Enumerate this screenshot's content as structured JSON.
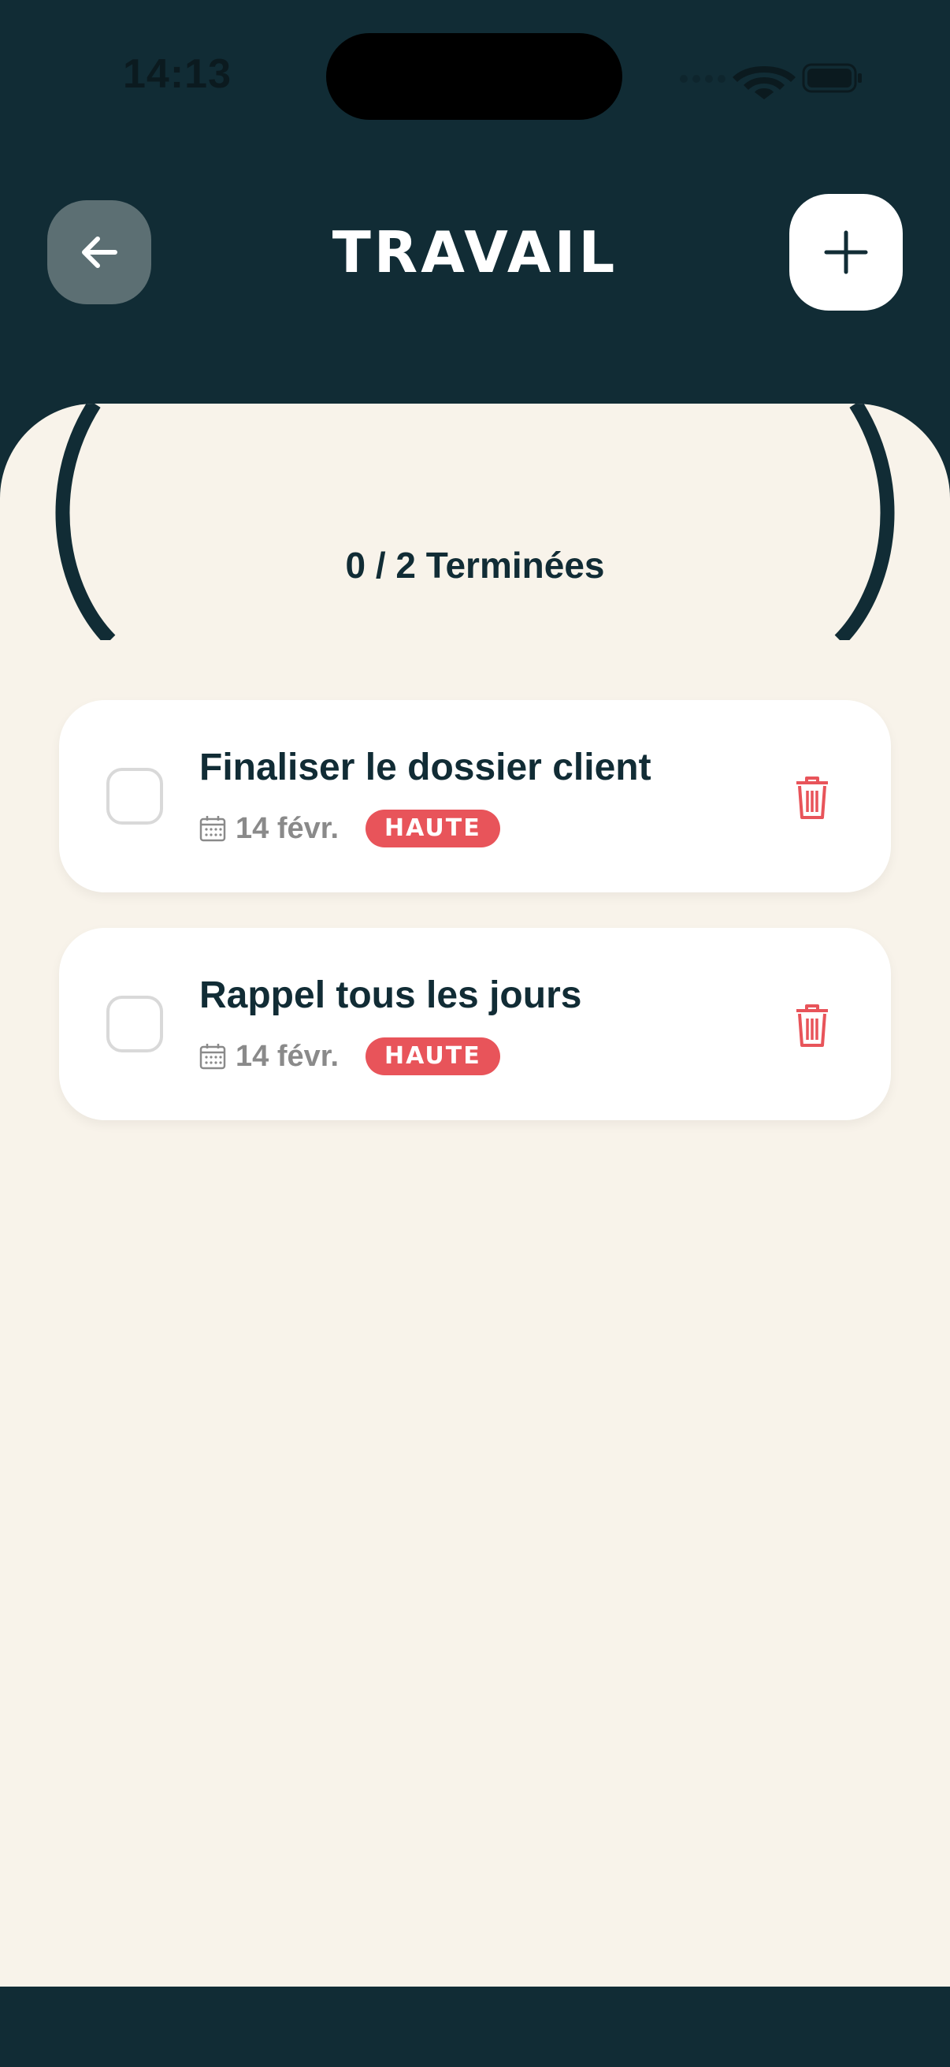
{
  "status_bar": {
    "time": "14:13"
  },
  "header": {
    "title": "TRAVAIL"
  },
  "progress": {
    "label": "0 / 2 Terminées",
    "completed": 0,
    "total": 2
  },
  "tasks": [
    {
      "title": "Finaliser le dossier client",
      "date": "14 févr.",
      "priority": "HAUTE",
      "done": false
    },
    {
      "title": "Rappel tous les jours",
      "date": "14 févr.",
      "priority": "HAUTE",
      "done": false
    }
  ],
  "icons": {
    "back": "arrow-left-icon",
    "add": "plus-icon",
    "calendar": "calendar-icon",
    "delete": "trash-icon"
  },
  "colors": {
    "header_bg": "#112c35",
    "content_bg": "#f8f3ea",
    "priority_high": "#e8545a",
    "delete": "#e8545a"
  }
}
